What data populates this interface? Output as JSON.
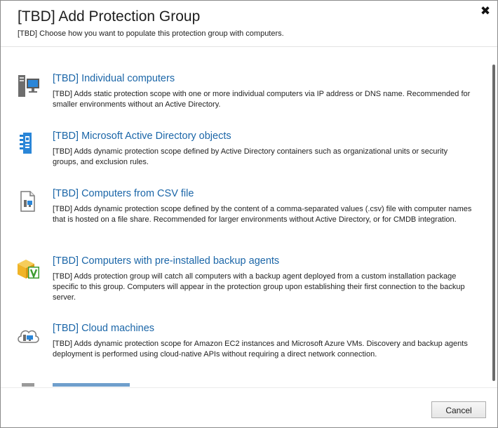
{
  "dialog": {
    "title": "[TBD] Add Protection Group",
    "subtitle": "[TBD] Choose how you want to populate this protection group with computers.",
    "close_icon": "close-icon"
  },
  "options": [
    {
      "title": "[TBD] Individual computers",
      "description": "[TBD] Adds static protection scope with one or more individual computers via IP address or DNS name. Recommended for smaller environments without an Active Directory.",
      "icon": "computer-icon"
    },
    {
      "title": "[TBD] Microsoft Active Directory objects",
      "description": "[TBD] Adds dynamic protection scope defined by Active Directory containers such as organizational units or security groups, and exclusion rules.",
      "icon": "active-directory-icon"
    },
    {
      "title": "[TBD] Computers from CSV file",
      "description": "[TBD] Adds dynamic protection scope defined by the content of a comma-separated values (.csv) file with computer names that is hosted on a file share. Recommended for larger environments without Active Directory, or for CMDB integration.",
      "icon": "csv-file-icon"
    },
    {
      "title": "[TBD] Computers with pre-installed backup agents",
      "description": "[TBD] Adds protection group will catch all computers with a backup agent deployed from a custom installation package specific to this group.  Computers will appear in the protection group upon establishing their first connection to the backup server.",
      "icon": "agent-package-icon"
    },
    {
      "title": "[TBD] Cloud machines",
      "description": "[TBD] Adds dynamic protection scope for Amazon EC2 instances and Microsoft Azure VMs. Discovery and backup agents deployment is performed using cloud-native APIs without requiring a direct network connection.",
      "icon": "cloud-machine-icon"
    }
  ],
  "footer": {
    "cancel_label": "Cancel"
  },
  "colors": {
    "link_blue": "#1b66a8",
    "agent_green": "#3b9b2f",
    "box_orange": "#f0b428"
  }
}
